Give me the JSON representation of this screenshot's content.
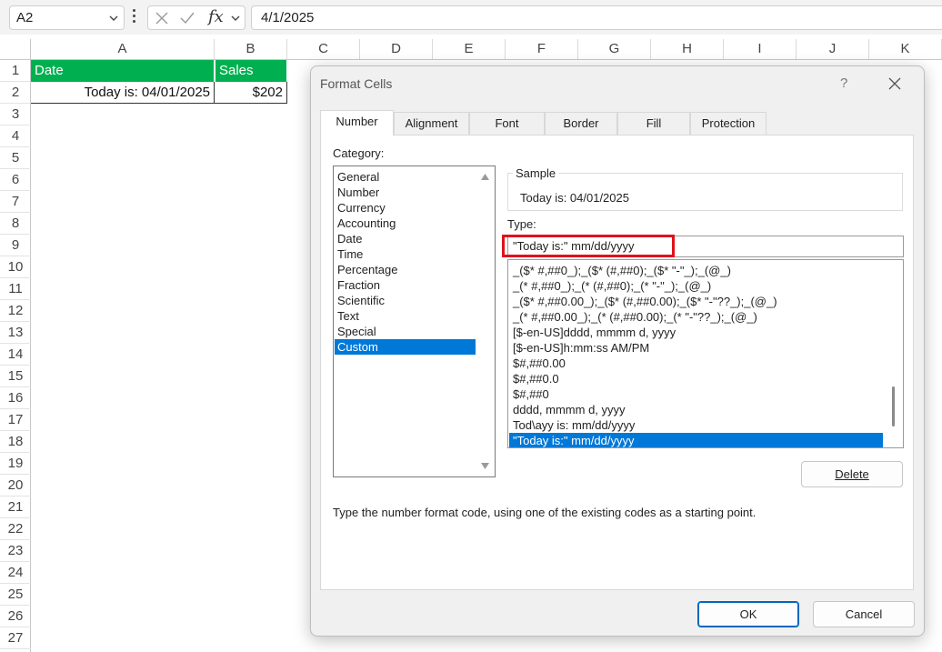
{
  "formula_bar": {
    "name_box": "A2",
    "fx": "fx",
    "content": "4/1/2025"
  },
  "grid": {
    "columns": [
      "A",
      "B",
      "C",
      "D",
      "E",
      "F",
      "G",
      "H",
      "I",
      "J",
      "K"
    ],
    "rows": [
      "1",
      "2",
      "3",
      "4",
      "5",
      "6",
      "7",
      "8",
      "9",
      "10",
      "11",
      "12",
      "13",
      "14",
      "15",
      "16",
      "17",
      "18",
      "19",
      "20",
      "21",
      "22",
      "23",
      "24",
      "25",
      "26",
      "27"
    ],
    "cells": {
      "a1": "Date",
      "b1": "Sales",
      "a2": "Today is: 04/01/2025",
      "b2": "$202"
    },
    "header_fill": "#00b050"
  },
  "dialog": {
    "title": "Format Cells",
    "help": "?",
    "tabs": [
      "Number",
      "Alignment",
      "Font",
      "Border",
      "Fill",
      "Protection"
    ],
    "active_tab": "Number",
    "category_label": "Category:",
    "categories": [
      "General",
      "Number",
      "Currency",
      "Accounting",
      "Date",
      "Time",
      "Percentage",
      "Fraction",
      "Scientific",
      "Text",
      "Special",
      "Custom"
    ],
    "selected_category": "Custom",
    "sample_label": "Sample",
    "sample_value": "Today is: 04/01/2025",
    "type_label": "Type:",
    "type_value": "\"Today is:\" mm/dd/yyyy",
    "formats": [
      "_($* #,##0_);_($* (#,##0);_($* \"-\"_);_(@_)",
      "_(* #,##0_);_(* (#,##0);_(* \"-\"_);_(@_)",
      "_($* #,##0.00_);_($* (#,##0.00);_($* \"-\"??_);_(@_)",
      "_(* #,##0.00_);_(* (#,##0.00);_(* \"-\"??_);_(@_)",
      "[$-en-US]dddd, mmmm d, yyyy",
      "[$-en-US]h:mm:ss AM/PM",
      "$#,##0.00",
      "$#,##0.0",
      "$#,##0",
      "dddd, mmmm d, yyyy",
      "Tod\\ayy is: mm/dd/yyyy",
      "\"Today is:\" mm/dd/yyyy"
    ],
    "selected_format": "\"Today is:\" mm/dd/yyyy",
    "delete_label": "Delete",
    "hint": "Type the number format code, using one of the existing codes as a starting point.",
    "ok_label": "OK",
    "cancel_label": "Cancel",
    "accent": "#0078d7",
    "highlight_color": "#e0121b"
  }
}
